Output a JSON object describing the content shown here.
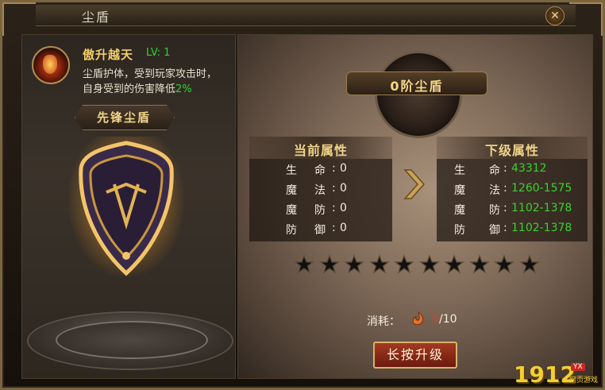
{
  "window": {
    "title": "尘盾",
    "close_symbol": "✕"
  },
  "skill": {
    "name": "傲升越天",
    "level": "LV: 1",
    "desc_line1": "尘盾护体，受到玩家攻击时，",
    "desc_line2_prefix": "自身受到的伤害降低",
    "desc_line2_pct": "2%",
    "icon": "fire-skill-icon"
  },
  "shield": {
    "name": "先锋尘盾",
    "icon": "shield-icon"
  },
  "tier": {
    "label": "0阶尘盾"
  },
  "current_attrs": {
    "header": "当前属性",
    "rows": [
      {
        "k1": "生",
        "k2": "命",
        "value": "0"
      },
      {
        "k1": "魔",
        "k2": "法",
        "value": "0"
      },
      {
        "k1": "魔",
        "k2": "防",
        "value": "0"
      },
      {
        "k1": "防",
        "k2": "御",
        "value": "0"
      }
    ]
  },
  "next_attrs": {
    "header": "下级属性",
    "rows": [
      {
        "k1": "生",
        "k2": "命",
        "value": "43312"
      },
      {
        "k1": "魔",
        "k2": "法",
        "value": "1260-1575"
      },
      {
        "k1": "魔",
        "k2": "防",
        "value": "1102-1378"
      },
      {
        "k1": "防",
        "k2": "御",
        "value": "1102-1378"
      }
    ]
  },
  "stars": {
    "filled": 0,
    "total": 10
  },
  "cost": {
    "label": "消耗：",
    "current": "0",
    "max": "/10",
    "icon": "material-icon"
  },
  "upgrade_button": "长按升级",
  "logo": {
    "main": "1912",
    "tag": "YX",
    "sub": "网页游戏"
  },
  "colors": {
    "green": "#39d12f",
    "gold": "#f0d38a",
    "red": "#e03a2a"
  }
}
